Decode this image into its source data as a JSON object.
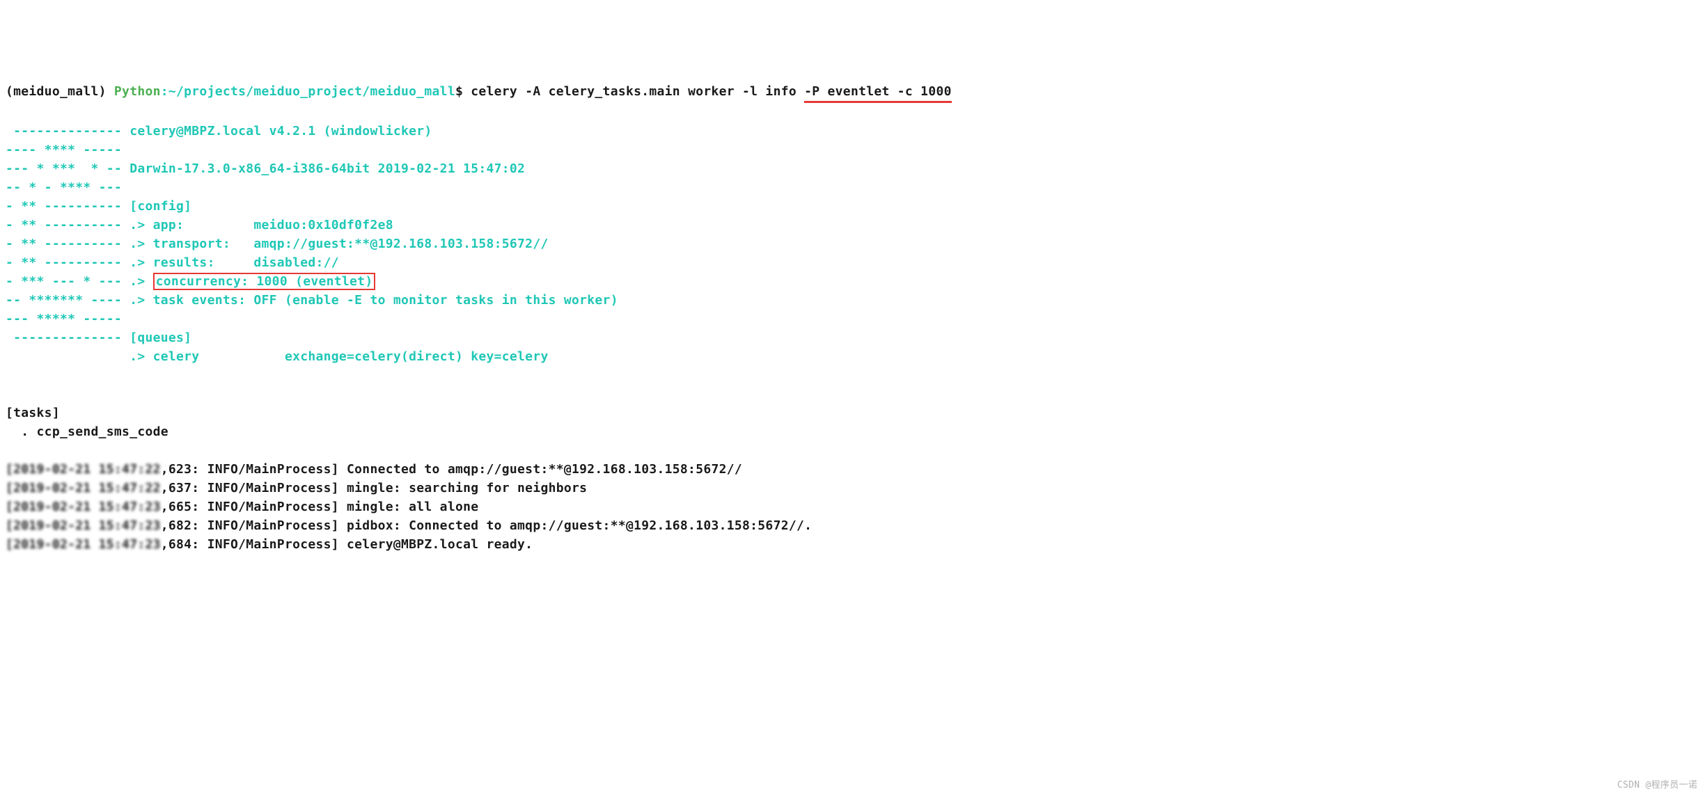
{
  "prompt": {
    "env": "(meiduo_mall) ",
    "user": "Python",
    "path": ":~/projects/meiduo_project/meiduo_mall",
    "dollar": "$ ",
    "cmd_main": "celery -A celery_tasks.main worker -l info ",
    "cmd_underlined": "-P eventlet -c 1000"
  },
  "banner": {
    "l1a": " -------------- ",
    "l1b": "celery@MBPZ.local v4.2.1 (windowlicker)",
    "l2": "---- **** -----",
    "l3a": "--- * ***  * -- ",
    "l3b": "Darwin-17.3.0-x86_64-i386-64bit 2019-02-21 15:47:02",
    "l4": "-- * - **** ---",
    "l5a": "- ** ---------- ",
    "l5b": "[config]",
    "l6a": "- ** ---------- ",
    "l6b": ".> app:         meiduo:0x10df0f2e8",
    "l7a": "- ** ---------- ",
    "l7b": ".> transport:   amqp://guest:**@192.168.103.158:5672//",
    "l8a": "- ** ---------- ",
    "l8b": ".> results:     disabled://",
    "l9a": "- *** --- * --- ",
    "l9b": ".> ",
    "l9c": "concurrency: 1000 (eventlet)",
    "l10a": "-- ******* ---- ",
    "l10b": ".> task events: OFF (enable -E to monitor tasks in this worker)",
    "l11": "--- ***** -----",
    "l12a": " -------------- ",
    "l12b": "[queues]",
    "l13a": "                ",
    "l13b": ".> celery           exchange=celery(direct) key=celery"
  },
  "tasks": {
    "header": "[tasks]",
    "item": "  . ccp_send_sms_code"
  },
  "logs": {
    "l1_blur": "[2019-02-21 15:47:22",
    "l1_rest": ",623: INFO/MainProcess] Connected to amqp://guest:**@192.168.103.158:5672//",
    "l2_blur": "[2019-02-21 15:47:22",
    "l2_rest": ",637: INFO/MainProcess] mingle: searching for neighbors",
    "l3_blur": "[2019-02-21 15:47:23",
    "l3_rest": ",665: INFO/MainProcess] mingle: all alone",
    "l4_blur": "[2019-02-21 15:47:23",
    "l4_rest": ",682: INFO/MainProcess] pidbox: Connected to amqp://guest:**@192.168.103.158:5672//.",
    "l5_blur": "[2019-02-21 15:47:23",
    "l5_rest": ",684: INFO/MainProcess] celery@MBPZ.local ready."
  },
  "watermark": "CSDN @程序员一诺"
}
